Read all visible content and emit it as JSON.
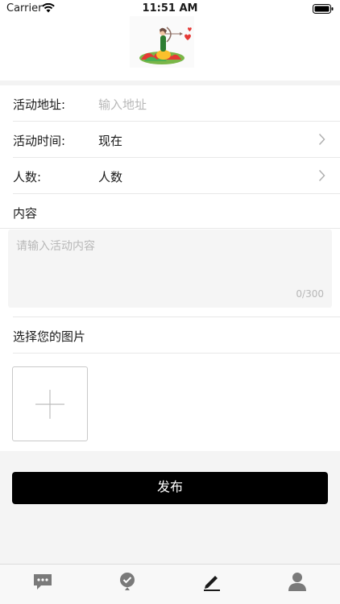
{
  "status_bar": {
    "carrier": "Carrier",
    "time": "11:51 AM"
  },
  "form": {
    "address": {
      "label": "活动地址:",
      "placeholder": "输入地址"
    },
    "time": {
      "label": "活动时间:",
      "value": "现在"
    },
    "people": {
      "label": "人数:",
      "value": "人数"
    },
    "content": {
      "label": "内容",
      "placeholder": "请输入活动内容",
      "counter": "0/300"
    },
    "images": {
      "label": "选择您的图片"
    }
  },
  "publish_button": "发布",
  "tabs": [
    {
      "icon": "chat-icon"
    },
    {
      "icon": "location-check-icon"
    },
    {
      "icon": "edit-icon",
      "selected": true
    },
    {
      "icon": "user-icon"
    }
  ],
  "colors": {
    "accent": "#000000",
    "background_gray": "#f4f4f4",
    "placeholder": "#b8b8b8"
  }
}
